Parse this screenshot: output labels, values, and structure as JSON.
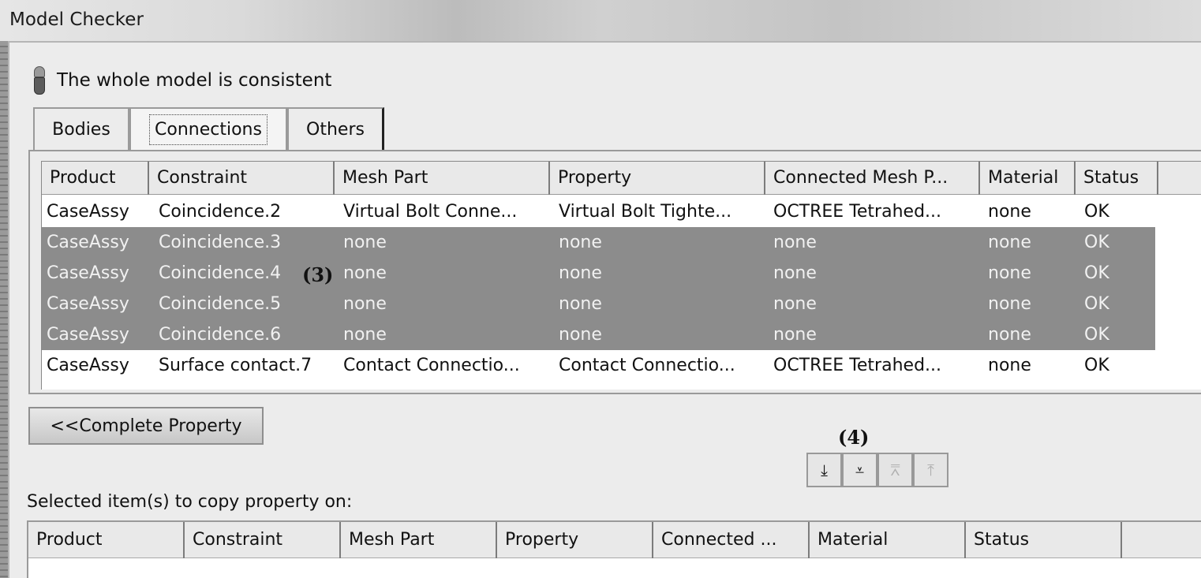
{
  "window": {
    "title": "Model Checker"
  },
  "status": {
    "text": "The whole model is consistent"
  },
  "tabs": [
    {
      "label": "Bodies"
    },
    {
      "label": "Connections"
    },
    {
      "label": "Others"
    }
  ],
  "main_table": {
    "columns": [
      "Product",
      "Constraint",
      "Mesh Part",
      "Property",
      "Connected Mesh P...",
      "Material",
      "Status"
    ],
    "rows": [
      [
        "CaseAssy",
        "Coincidence.2",
        "Virtual Bolt Conne...",
        "Virtual Bolt Tighte...",
        "OCTREE Tetrahed...",
        "none",
        "OK"
      ],
      [
        "CaseAssy",
        "Coincidence.3",
        "none",
        "none",
        "none",
        "none",
        "OK"
      ],
      [
        "CaseAssy",
        "Coincidence.4",
        "none",
        "none",
        "none",
        "none",
        "OK"
      ],
      [
        "CaseAssy",
        "Coincidence.5",
        "none",
        "none",
        "none",
        "none",
        "OK"
      ],
      [
        "CaseAssy",
        "Coincidence.6",
        "none",
        "none",
        "none",
        "none",
        "OK"
      ],
      [
        "CaseAssy",
        "Surface contact.7",
        "Contact Connectio...",
        "Contact Connectio...",
        "OCTREE Tetrahed...",
        "none",
        "OK"
      ]
    ],
    "selected_rows": [
      1,
      2,
      3,
      4
    ]
  },
  "callouts": {
    "c3": "(3)",
    "c4": "(4)"
  },
  "buttons": {
    "complete_property": "<<Complete Property"
  },
  "arrows": [
    {
      "icon": "move-to-bottom-icon",
      "glyph": "⤓",
      "enabled": true
    },
    {
      "icon": "move-down-icon",
      "glyph": "⩡",
      "enabled": true
    },
    {
      "icon": "move-up-icon",
      "glyph": "⩞",
      "enabled": false
    },
    {
      "icon": "move-to-top-icon",
      "glyph": "⤒",
      "enabled": false
    }
  ],
  "selection": {
    "label": "Selected item(s) to copy property on:",
    "columns": [
      "Product",
      "Constraint",
      "Mesh Part",
      "Property",
      "Connected ...",
      "Material",
      "Status"
    ]
  }
}
